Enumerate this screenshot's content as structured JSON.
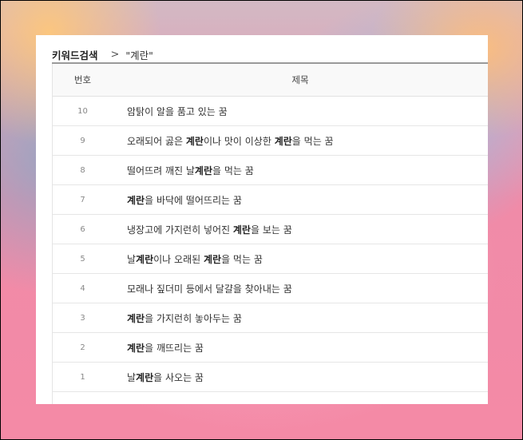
{
  "breadcrumb": {
    "root": "키워드검색",
    "separator": ">",
    "current": "\"계란\""
  },
  "table": {
    "headers": {
      "number": "번호",
      "title": "제목"
    },
    "rows": [
      {
        "num": "10",
        "parts": [
          [
            "암탉이 알을 품고 있는 꿈",
            false
          ]
        ]
      },
      {
        "num": "9",
        "parts": [
          [
            "오래되어 곯은 ",
            false
          ],
          [
            "계란",
            true
          ],
          [
            "이나 맛이 이상한 ",
            false
          ],
          [
            "계란",
            true
          ],
          [
            "을 먹는 꿈",
            false
          ]
        ]
      },
      {
        "num": "8",
        "parts": [
          [
            "떨어뜨려 깨진 날",
            false
          ],
          [
            "계란",
            true
          ],
          [
            "을 먹는 꿈",
            false
          ]
        ]
      },
      {
        "num": "7",
        "parts": [
          [
            "계란",
            true
          ],
          [
            "을 바닥에 떨어뜨리는 꿈",
            false
          ]
        ]
      },
      {
        "num": "6",
        "parts": [
          [
            "냉장고에 가지런히 넣어진 ",
            false
          ],
          [
            "계란",
            true
          ],
          [
            "을 보는 꿈",
            false
          ]
        ]
      },
      {
        "num": "5",
        "parts": [
          [
            "날",
            false
          ],
          [
            "계란",
            true
          ],
          [
            "이나 오래된 ",
            false
          ],
          [
            "계란",
            true
          ],
          [
            "을 먹는 꿈",
            false
          ]
        ]
      },
      {
        "num": "4",
        "parts": [
          [
            "모래나 짚더미 등에서 달걀을 찾아내는 꿈",
            false
          ]
        ]
      },
      {
        "num": "3",
        "parts": [
          [
            "계란",
            true
          ],
          [
            "을 가지런히 놓아두는 꿈",
            false
          ]
        ]
      },
      {
        "num": "2",
        "parts": [
          [
            "계란",
            true
          ],
          [
            "을 깨뜨리는 꿈",
            false
          ]
        ]
      },
      {
        "num": "1",
        "parts": [
          [
            "날",
            false
          ],
          [
            "계란",
            true
          ],
          [
            "을 사오는 꿈",
            false
          ]
        ]
      }
    ]
  }
}
